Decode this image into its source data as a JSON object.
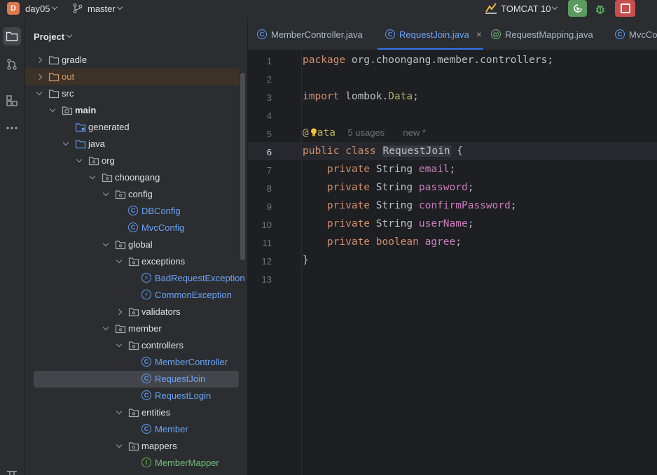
{
  "topbar": {
    "project_initial": "D",
    "project_name": "day05",
    "branch_name": "master",
    "run_config": "TOMCAT 10"
  },
  "project_panel": {
    "title": "Project",
    "tree": [
      {
        "label": "gradle",
        "depth": 0,
        "expanded": false,
        "icon": "folder-icon"
      },
      {
        "label": "out",
        "depth": 0,
        "expanded": false,
        "icon": "folder-excluded-icon"
      },
      {
        "label": "src",
        "depth": 0,
        "expanded": true,
        "icon": "folder-icon"
      },
      {
        "label": "main",
        "depth": 1,
        "expanded": true,
        "icon": "module-folder-icon"
      },
      {
        "label": "generated",
        "depth": 2,
        "expanded": null,
        "icon": "generated-folder-icon"
      },
      {
        "label": "java",
        "depth": 2,
        "expanded": true,
        "icon": "source-folder-icon"
      },
      {
        "label": "org",
        "depth": 3,
        "expanded": true,
        "icon": "package-icon"
      },
      {
        "label": "choongang",
        "depth": 4,
        "expanded": true,
        "icon": "package-icon"
      },
      {
        "label": "config",
        "depth": 5,
        "expanded": true,
        "icon": "package-icon"
      },
      {
        "label": "DBConfig",
        "depth": 6,
        "expanded": null,
        "icon": "class-icon"
      },
      {
        "label": "MvcConfig",
        "depth": 6,
        "expanded": null,
        "icon": "class-icon"
      },
      {
        "label": "global",
        "depth": 5,
        "expanded": true,
        "icon": "package-icon"
      },
      {
        "label": "exceptions",
        "depth": 6,
        "expanded": true,
        "icon": "package-icon"
      },
      {
        "label": "BadRequestException",
        "depth": 7,
        "expanded": null,
        "icon": "exception-class-icon"
      },
      {
        "label": "CommonException",
        "depth": 7,
        "expanded": null,
        "icon": "exception-class-icon"
      },
      {
        "label": "validators",
        "depth": 6,
        "expanded": false,
        "icon": "package-icon"
      },
      {
        "label": "member",
        "depth": 5,
        "expanded": true,
        "icon": "package-icon"
      },
      {
        "label": "controllers",
        "depth": 6,
        "expanded": true,
        "icon": "package-icon"
      },
      {
        "label": "MemberController",
        "depth": 7,
        "expanded": null,
        "icon": "class-icon"
      },
      {
        "label": "RequestJoin",
        "depth": 7,
        "expanded": null,
        "icon": "class-icon",
        "selected": true
      },
      {
        "label": "RequestLogin",
        "depth": 7,
        "expanded": null,
        "icon": "class-icon"
      },
      {
        "label": "entities",
        "depth": 6,
        "expanded": true,
        "icon": "package-icon"
      },
      {
        "label": "Member",
        "depth": 7,
        "expanded": null,
        "icon": "class-icon"
      },
      {
        "label": "mappers",
        "depth": 6,
        "expanded": true,
        "icon": "package-icon"
      },
      {
        "label": "MemberMapper",
        "depth": 7,
        "expanded": null,
        "icon": "interface-icon"
      }
    ]
  },
  "tabs": [
    {
      "label": "MemberController.java",
      "icon": "class-icon",
      "active": false
    },
    {
      "label": "RequestJoin.java",
      "icon": "class-icon",
      "active": true,
      "close": "×"
    },
    {
      "label": "RequestMapping.java",
      "icon": "annotation-icon",
      "active": false
    },
    {
      "label": "MvcCo",
      "icon": "class-icon",
      "active": false
    }
  ],
  "editor": {
    "current_line": 6,
    "line_numbers": [
      "1",
      "2",
      "3",
      "4",
      "5",
      "6",
      "7",
      "8",
      "9",
      "10",
      "11",
      "12",
      "13"
    ],
    "code": {
      "l1_kw": "package",
      "l1_rest": " org.choongang.member.controllers;",
      "l3_kw": "import",
      "l3_rest": " lombok.",
      "l3_ann": "Data",
      "l3_end": ";",
      "l5_at": "@",
      "l5_ann": "ata",
      "l5_usages": "5 usages",
      "l5_new": "new *",
      "l6_kw": "public class",
      "l6_cls": "RequestJoin",
      "l6_end": " {",
      "f1_kw": "private",
      "f1_type": " String ",
      "f1_name": "email",
      "f2_kw": "private",
      "f2_type": " String ",
      "f2_name": "password",
      "f3_kw": "private",
      "f3_type": " String ",
      "f3_name": "confirmPassword",
      "f4_kw": "private",
      "f4_type": " String ",
      "f4_name": "userName",
      "f5_kw": "private",
      "f5_type": " boolean",
      "f5_name": "agree",
      "semi": ";",
      "l12": "}"
    }
  },
  "colors": {
    "accent": "#3574f0",
    "run_green": "#5b9b5d",
    "stop_red": "#c94f4f",
    "keyword": "#cf8e6d",
    "field": "#c77dbb",
    "annotation": "#b3ae60"
  }
}
